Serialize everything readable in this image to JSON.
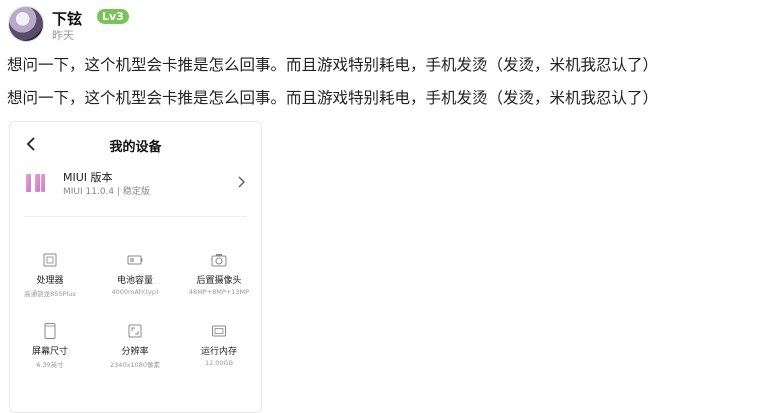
{
  "user": {
    "name": "下铉",
    "level": "Lv3",
    "time": "昨天"
  },
  "post": {
    "line1": "想问一下，这个机型会卡推是怎么回事。而且游戏特别耗电，手机发烫（发烫，米机我忍认了）",
    "line2": "想问一下，这个机型会卡推是怎么回事。而且游戏特别耗电，手机发烫（发烫，米机我忍认了）"
  },
  "device": {
    "title": "我的设备",
    "miui_label": "MIUI 版本",
    "miui_version": "MIUI 11.0.4 | 稳定版",
    "specs": [
      {
        "name": "处理器",
        "value": "高通骁龙855Plus",
        "icon": "processor-icon"
      },
      {
        "name": "电池容量",
        "value": "4000mAh(typ)",
        "icon": "battery-icon"
      },
      {
        "name": "后置摄像头",
        "value": "48MP+8MP+13MP",
        "icon": "camera-icon"
      },
      {
        "name": "屏幕尺寸",
        "value": "6.39英寸",
        "icon": "screen-icon"
      },
      {
        "name": "分辨率",
        "value": "2340x1080像素",
        "icon": "resolution-icon"
      },
      {
        "name": "运行内存",
        "value": "12.00GB",
        "icon": "memory-icon"
      }
    ]
  },
  "colors": {
    "badge": "#79c45a",
    "text": "#222222",
    "muted": "#999999"
  }
}
